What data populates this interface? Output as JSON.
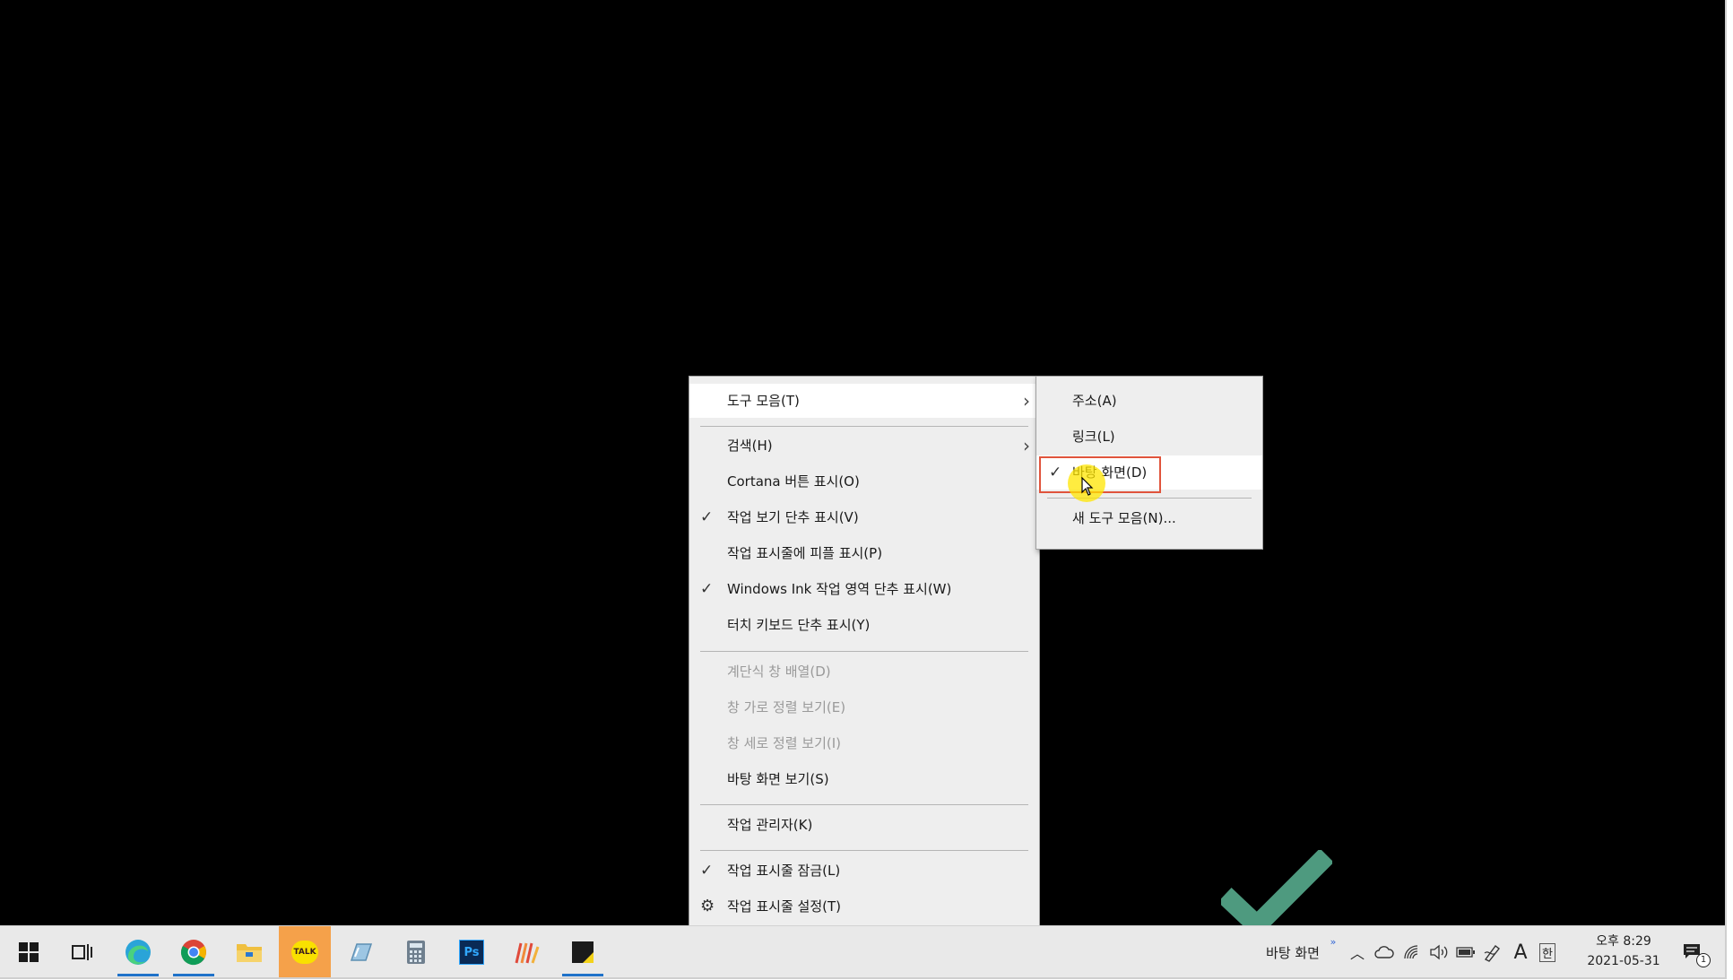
{
  "main_menu": {
    "items": [
      {
        "label": "도구 모음(T)",
        "checked": false,
        "submenu": true,
        "disabled": false,
        "highlighted": true
      },
      {
        "label": "검색(H)",
        "checked": false,
        "submenu": true,
        "disabled": false
      },
      {
        "label": "Cortana 버튼 표시(O)",
        "checked": false,
        "submenu": false,
        "disabled": false
      },
      {
        "label": "작업 보기 단추 표시(V)",
        "checked": true,
        "submenu": false,
        "disabled": false
      },
      {
        "label": "작업 표시줄에 피플 표시(P)",
        "checked": false,
        "submenu": false,
        "disabled": false
      },
      {
        "label": "Windows Ink 작업 영역 단추 표시(W)",
        "checked": true,
        "submenu": false,
        "disabled": false
      },
      {
        "label": "터치 키보드 단추 표시(Y)",
        "checked": false,
        "submenu": false,
        "disabled": false
      },
      {
        "label": "계단식 창 배열(D)",
        "checked": false,
        "submenu": false,
        "disabled": true
      },
      {
        "label": "창 가로 정렬 보기(E)",
        "checked": false,
        "submenu": false,
        "disabled": true
      },
      {
        "label": "창 세로 정렬 보기(I)",
        "checked": false,
        "submenu": false,
        "disabled": true
      },
      {
        "label": "바탕 화면 보기(S)",
        "checked": false,
        "submenu": false,
        "disabled": false
      },
      {
        "label": "작업 관리자(K)",
        "checked": false,
        "submenu": false,
        "disabled": false
      },
      {
        "label": "작업 표시줄 잠금(L)",
        "checked": true,
        "submenu": false,
        "disabled": false
      },
      {
        "label": "작업 표시줄 설정(T)",
        "checked": false,
        "submenu": false,
        "disabled": false,
        "icon": "gear-icon"
      }
    ]
  },
  "sub_menu": {
    "items": [
      {
        "label": "주소(A)",
        "checked": false
      },
      {
        "label": "링크(L)",
        "checked": false
      },
      {
        "label": "바탕 화면(D)",
        "checked": true,
        "highlighted": true
      },
      {
        "label": "새 도구 모음(N)...",
        "checked": false
      }
    ]
  },
  "taskbar": {
    "apps": [
      {
        "icon": "windows-start-icon"
      },
      {
        "icon": "task-view-icon"
      },
      {
        "icon": "edge-icon",
        "running": true
      },
      {
        "icon": "chrome-icon",
        "running": true
      },
      {
        "icon": "file-explorer-icon"
      },
      {
        "icon": "kakaotalk-icon",
        "text": "TALK",
        "active": true
      },
      {
        "icon": "paint-icon"
      },
      {
        "icon": "calculator-icon"
      },
      {
        "icon": "photoshop-icon",
        "text": "Ps"
      },
      {
        "icon": "app-stripes-icon"
      },
      {
        "icon": "sticky-notes-icon",
        "running": true
      }
    ],
    "desktop_toolbar_label": "바탕 화면",
    "ime_label": "A",
    "lang_label": "한",
    "clock_time": "오후 8:29",
    "clock_date": "2021-05-31",
    "notification_count": "1"
  },
  "colors": {
    "accent": "#1f72c9",
    "highlight_box": "#e0543c",
    "check_overlay": "#4e9a7f",
    "kakao": "#f9e000"
  }
}
